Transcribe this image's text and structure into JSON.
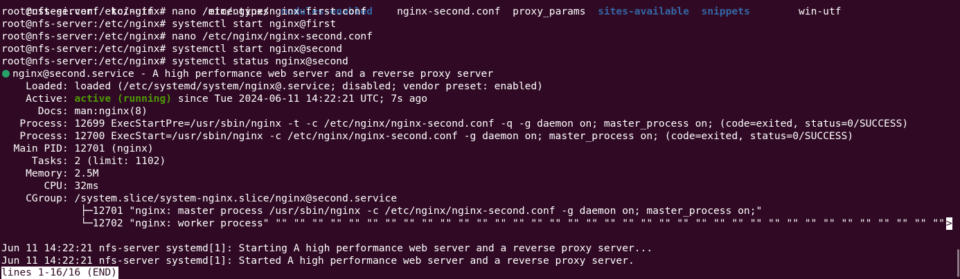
{
  "top_cutoff": {
    "segments": [
      {
        "text": "rustegi.conf  koi-utf         mime.types  ",
        "style": "normal"
      },
      {
        "text": "modules-enabled",
        "style": "dir"
      },
      {
        "text": "    nginx-second.conf  proxy_params  ",
        "style": "normal"
      },
      {
        "text": "sites-available  snippets",
        "style": "dir"
      },
      {
        "text": "        win-utf",
        "style": "normal"
      }
    ]
  },
  "commands": [
    {
      "prompt": "root@nfs-server:/etc/nginx# ",
      "command": "nano /etc/nginx/nginx-first.conf"
    },
    {
      "prompt": "root@nfs-server:/etc/nginx# ",
      "command": "systemctl start nginx@first"
    },
    {
      "prompt": "root@nfs-server:/etc/nginx# ",
      "command": "nano /etc/nginx/nginx-second.conf"
    },
    {
      "prompt": "root@nfs-server:/etc/nginx# ",
      "command": "systemctl start nginx@second"
    },
    {
      "prompt": "root@nfs-server:/etc/nginx# ",
      "command": "systemctl status nginx@second"
    }
  ],
  "service": {
    "header": "nginx@second.service - A high performance web server and a reverse proxy server",
    "status_dot_color": "#26a269",
    "loaded_label": "    Loaded: ",
    "loaded_value": "loaded (/etc/systemd/system/nginx@.service; disabled; vendor preset: enabled)",
    "active_label": "    Active: ",
    "active_state": "active (running)",
    "active_rest": " since Tue 2024-06-11 14:22:21 UTC; 7s ago",
    "docs_label": "      Docs: ",
    "docs_value": "man:nginx(8)",
    "process1_label": "   Process: ",
    "process1_value": "12699 ExecStartPre=/usr/sbin/nginx -t -c /etc/nginx/nginx-second.conf -q -g daemon on; master_process on; (code=exited, status=0/SUCCESS)",
    "process2_label": "   Process: ",
    "process2_value": "12700 ExecStart=/usr/sbin/nginx -c /etc/nginx/nginx-second.conf -g daemon on; master_process on; (code=exited, status=0/SUCCESS)",
    "mainpid_label": "  Main PID: ",
    "mainpid_value": "12701 (nginx)",
    "tasks_label": "     Tasks: ",
    "tasks_value": "2 (limit: 1102)",
    "memory_label": "    Memory: ",
    "memory_value": "2.5M",
    "cpu_label": "       CPU: ",
    "cpu_value": "32ms",
    "cgroup_label": "    CGroup: ",
    "cgroup_value": "/system.slice/system-nginx.slice/nginx@second.service",
    "cgroup_child1": "             ├─12701 \"nginx: master process /usr/sbin/nginx -c /etc/nginx/nginx-second.conf -g daemon on; master_process on;\"",
    "cgroup_child2": "             └─12702 \"nginx: worker process\" \"\" \"\" \"\" \"\" \"\" \"\" \"\" \"\" \"\" \"\" \"\" \"\" \"\" \"\" \"\" \"\" \"\" \"\" \"\" \"\" \"\" \"\" \"\" \"\" \"\" \"\" \"\" \"\" \"\" \"\" \"\" \"\" \"\" \"\" \"\" \"\" \"\" \"\" \"\" \"\" \"\"",
    "trunc_marker": ">"
  },
  "journal": [
    "Jun 11 14:22:21 nfs-server systemd[1]: Starting A high performance web server and a reverse proxy server...",
    "Jun 11 14:22:21 nfs-server systemd[1]: Started A high performance web server and a reverse proxy server."
  ],
  "pager_status": "lines 1-16/16 (END)",
  "colors": {
    "background": "#300a24",
    "foreground": "#ffffff",
    "active_green": "#4e9a06",
    "directory_blue": "#3465a4"
  }
}
